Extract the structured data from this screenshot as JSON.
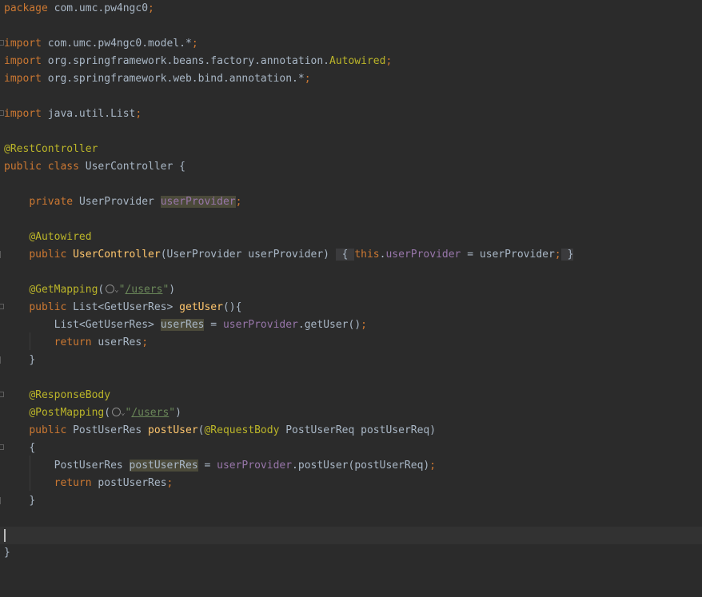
{
  "code": {
    "package_kw": "package",
    "package_name": "com.umc.pw4ngc0",
    "semi": ";",
    "import_kw": "import",
    "import1": "com.umc.pw4ngc0.model.*",
    "import2_path": "org.springframework.beans.factory.annotation.",
    "import2_class": "Autowired",
    "import3": "org.springframework.web.bind.annotation.*",
    "import4": "java.util.List",
    "ann_rest": "@RestController",
    "public_kw": "public",
    "class_kw": "class",
    "class_name": "UserController",
    "open_brace": "{",
    "close_brace": "}",
    "private_kw": "private",
    "provider_type": "UserProvider",
    "provider_field": "userProvider",
    "ann_autowired": "@Autowired",
    "ctor_name": "UserController",
    "ctor_params": "(UserProvider userProvider)",
    "this_kw": "this",
    "dot": ".",
    "assign": " = ",
    "ctor_arg": "userProvider",
    "ann_get": "@GetMapping",
    "paren_open": "(",
    "paren_close": ")",
    "quote": "\"",
    "users_path": "/users",
    "get_return_type": "List<GetUserRes>",
    "get_method": "getUser",
    "get_method_sig_tail": "(){",
    "get_local_type": "List<GetUserRes>",
    "get_local_var": "userRes",
    "get_call": "getUser()",
    "return_kw": "return",
    "get_return_val": "userRes",
    "ann_response_body": "@ResponseBody",
    "ann_post": "@PostMapping",
    "post_return_type": "PostUserRes",
    "post_method": "postUser",
    "ann_request_body": "@RequestBody",
    "post_params": "PostUserReq postUserReq)",
    "post_local_type": "PostUserRes",
    "post_local_var": "postUserRes",
    "post_call": "postUser(postUserReq)",
    "post_return_val": "postUserRes"
  },
  "icons": {
    "globe": "globe-icon",
    "chevron": "chevron-down-icon"
  },
  "glyphs": {
    "chevron": "⌄"
  },
  "colors": {
    "background": "#2b2b2b",
    "keyword": "#cc7832",
    "annotation": "#bbb529",
    "string": "#6a8759",
    "method": "#ffc66d",
    "field": "#9876aa",
    "text": "#a9b7c6"
  }
}
